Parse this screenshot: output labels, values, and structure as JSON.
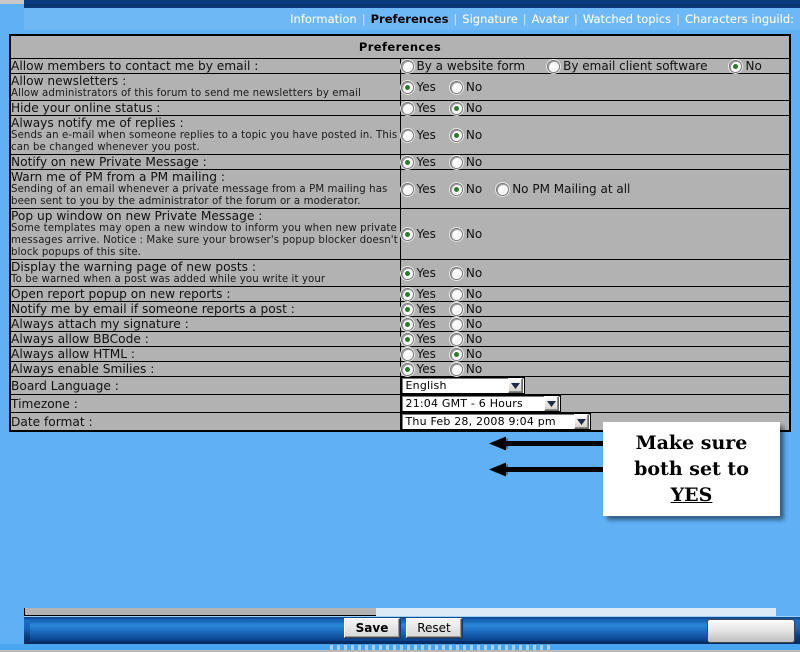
{
  "nav": {
    "items": [
      {
        "label": "Information",
        "active": false
      },
      {
        "label": "Preferences",
        "active": true
      },
      {
        "label": "Signature",
        "active": false
      },
      {
        "label": "Avatar",
        "active": false
      },
      {
        "label": "Watched topics",
        "active": false
      },
      {
        "label": "Characters inguild:",
        "active": false
      }
    ],
    "separator": "|"
  },
  "panel": {
    "title": "Preferences"
  },
  "rows": [
    {
      "label": "Allow members to contact me by email :",
      "desc": "",
      "type": "radio",
      "options": [
        {
          "label": "By a website form",
          "selected": false
        },
        {
          "label": "By email client software",
          "selected": false
        },
        {
          "label": "No",
          "selected": true
        }
      ]
    },
    {
      "label": "Allow newsletters :",
      "desc": "Allow administrators of this forum to send me newsletters by email",
      "type": "radio",
      "options": [
        {
          "label": "Yes",
          "selected": true
        },
        {
          "label": "No",
          "selected": false
        }
      ]
    },
    {
      "label": "Hide your online status :",
      "desc": "",
      "type": "radio",
      "options": [
        {
          "label": "Yes",
          "selected": false
        },
        {
          "label": "No",
          "selected": true
        }
      ]
    },
    {
      "label": "Always notify me of replies :",
      "desc": "Sends an e-mail when someone replies to a topic you have posted in. This can be changed whenever you post.",
      "type": "radio",
      "options": [
        {
          "label": "Yes",
          "selected": false
        },
        {
          "label": "No",
          "selected": true
        }
      ]
    },
    {
      "label": "Notify on new Private Message :",
      "desc": "",
      "type": "radio",
      "options": [
        {
          "label": "Yes",
          "selected": true
        },
        {
          "label": "No",
          "selected": false
        }
      ]
    },
    {
      "label": "Warn me of PM from a PM mailing :",
      "desc": "Sending of an email whenever a private message from a PM mailing has been sent to you by the administrator of the forum or a moderator.",
      "type": "radio",
      "options": [
        {
          "label": "Yes",
          "selected": false
        },
        {
          "label": "No",
          "selected": true
        },
        {
          "label": "No PM Mailing at all",
          "selected": false
        }
      ]
    },
    {
      "label": "Pop up window on new Private Message :",
      "desc": "Some templates may open a new window to inform you when new private messages arrive. Notice : Make sure your browser's popup blocker doesn't block popups of this site.",
      "type": "radio",
      "options": [
        {
          "label": "Yes",
          "selected": true
        },
        {
          "label": "No",
          "selected": false
        }
      ]
    },
    {
      "label": "Display the warning page of new posts  :",
      "desc": "To be warned when a post was added while you write it your",
      "type": "radio",
      "options": [
        {
          "label": "Yes",
          "selected": true
        },
        {
          "label": "No",
          "selected": false
        }
      ]
    },
    {
      "label": "Open report popup on new reports :",
      "desc": "",
      "type": "radio",
      "options": [
        {
          "label": "Yes",
          "selected": true
        },
        {
          "label": "No",
          "selected": false
        }
      ]
    },
    {
      "label": "Notify me by email if someone reports a post :",
      "desc": "",
      "type": "radio",
      "options": [
        {
          "label": "Yes",
          "selected": true
        },
        {
          "label": "No",
          "selected": false
        }
      ]
    },
    {
      "label": "Always attach my signature :",
      "desc": "",
      "type": "radio",
      "options": [
        {
          "label": "Yes",
          "selected": true
        },
        {
          "label": "No",
          "selected": false
        }
      ]
    },
    {
      "label": "Always allow BBCode :",
      "desc": "",
      "type": "radio",
      "options": [
        {
          "label": "Yes",
          "selected": true
        },
        {
          "label": "No",
          "selected": false
        }
      ]
    },
    {
      "label": "Always allow HTML :",
      "desc": "",
      "type": "radio",
      "options": [
        {
          "label": "Yes",
          "selected": false
        },
        {
          "label": "No",
          "selected": true
        }
      ]
    },
    {
      "label": "Always enable Smilies :",
      "desc": "",
      "type": "radio",
      "options": [
        {
          "label": "Yes",
          "selected": true
        },
        {
          "label": "No",
          "selected": false
        }
      ]
    },
    {
      "label": "Board Language :",
      "desc": "",
      "type": "select",
      "width": "w-lang",
      "value": "English"
    },
    {
      "label": "Timezone :",
      "desc": "",
      "type": "select",
      "width": "w-tz",
      "value": "21:04 GMT - 6 Hours"
    },
    {
      "label": "Date format :",
      "desc": "",
      "type": "select",
      "width": "w-date",
      "value": "Thu Feb 28, 2008 9:04 pm"
    }
  ],
  "annotation": {
    "line1": "Make sure",
    "line2": "both set to",
    "line3": "YES"
  },
  "footer": {
    "save_label": "Save",
    "reset_label": "Reset"
  },
  "colors": {
    "page_blue": "#5fb0f5",
    "nav_blue": "#6fb8f6",
    "cell_gray": "#b2b2b2",
    "radio_dot_green": "#2d7a2d",
    "footer_blue": "#1462b8",
    "annotation_bg": "#ffffff"
  }
}
